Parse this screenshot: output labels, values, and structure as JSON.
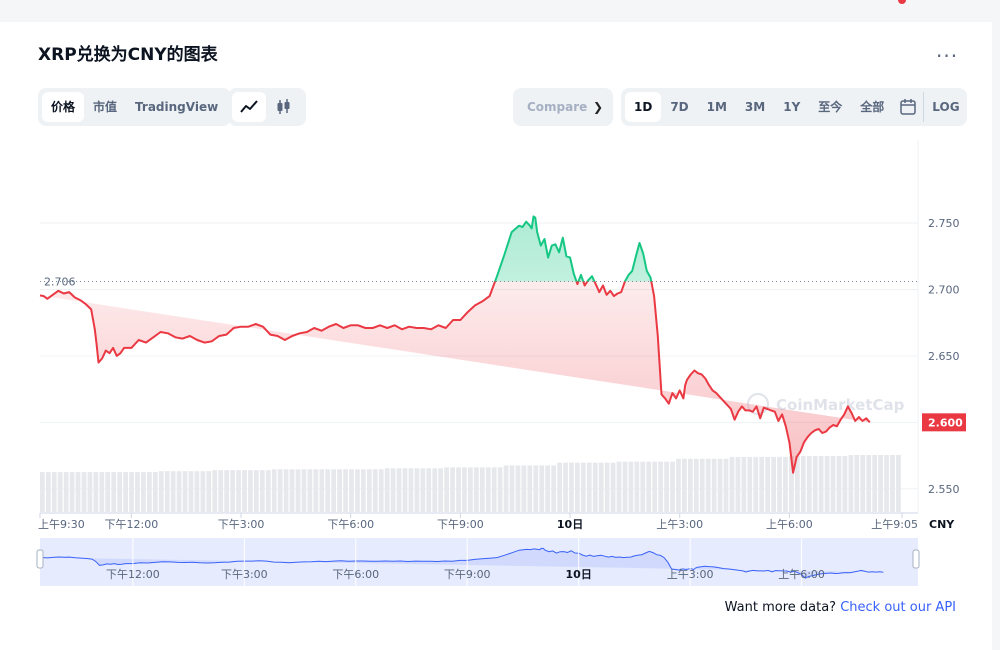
{
  "title": "XRP兑换为CNY的图表",
  "more_label": "...",
  "view_tabs": [
    {
      "label": "价格",
      "active": true
    },
    {
      "label": "市值",
      "active": false
    },
    {
      "label": "TradingView",
      "active": false
    }
  ],
  "chart_type_icons": [
    {
      "icon": "line-chart-icon",
      "active": true
    },
    {
      "icon": "candlestick-icon",
      "active": false
    }
  ],
  "compare_label": "Compare",
  "range_tabs": [
    {
      "label": "1D",
      "active": true
    },
    {
      "label": "7D",
      "active": false
    },
    {
      "label": "1M",
      "active": false
    },
    {
      "label": "3M",
      "active": false
    },
    {
      "label": "1Y",
      "active": false
    },
    {
      "label": "至今",
      "active": false
    },
    {
      "label": "全部",
      "active": false
    }
  ],
  "calendar_icon": "calendar-icon",
  "log_label": "LOG",
  "footer": {
    "text": "Want more data?",
    "link": "Check out our API"
  },
  "watermark": "CoinMarketCap",
  "colors": {
    "up": "#16c784",
    "down": "#ea3943",
    "accent": "#3861fb"
  },
  "chart_data": {
    "type": "line",
    "currency": "CNY",
    "open_price_label": "2.706",
    "current_price_label": "2.600",
    "open_price": 2.706,
    "current_price": 2.6,
    "y_ticks": [
      "2.750",
      "2.700",
      "2.650",
      "2.600",
      "2.550"
    ],
    "y_tick_values": [
      2.75,
      2.7,
      2.65,
      2.6,
      2.55
    ],
    "ylim": [
      2.5325,
      2.8125
    ],
    "x_ticks": [
      "上午9:30",
      "下午12:00",
      "下午3:00",
      "下午6:00",
      "下午9:00",
      "10日",
      "上午3:00",
      "上午6:00",
      "上午9:05"
    ],
    "x_tick_hours": [
      0,
      2.5,
      5.5,
      8.5,
      11.5,
      14.5,
      17.5,
      20.5,
      23.58
    ],
    "navigator_ticks": [
      "下午12:00",
      "下午3:00",
      "下午6:00",
      "下午9:00",
      "10日",
      "上午3:00",
      "上午6:00"
    ],
    "navigator_tick_hours": [
      2.5,
      5.5,
      8.5,
      11.5,
      14.5,
      17.5,
      20.5
    ],
    "hours": [
      0.0,
      0.1,
      0.2,
      0.35,
      0.5,
      0.65,
      0.8,
      0.95,
      1.1,
      1.25,
      1.4,
      1.5,
      1.55,
      1.6,
      1.7,
      1.8,
      1.9,
      2.0,
      2.1,
      2.2,
      2.3,
      2.4,
      2.5,
      2.7,
      2.9,
      3.1,
      3.3,
      3.5,
      3.7,
      3.9,
      4.1,
      4.3,
      4.5,
      4.7,
      4.9,
      5.1,
      5.3,
      5.5,
      5.7,
      5.9,
      6.1,
      6.3,
      6.5,
      6.7,
      6.9,
      7.1,
      7.3,
      7.5,
      7.7,
      7.9,
      8.1,
      8.3,
      8.5,
      8.7,
      8.9,
      9.1,
      9.3,
      9.5,
      9.7,
      9.9,
      10.1,
      10.3,
      10.5,
      10.7,
      10.9,
      11.1,
      11.3,
      11.5,
      11.7,
      11.9,
      12.1,
      12.3,
      12.5,
      12.7,
      12.9,
      13.1,
      13.2,
      13.3,
      13.4,
      13.45,
      13.5,
      13.55,
      13.6,
      13.7,
      13.8,
      13.9,
      14.0,
      14.1,
      14.2,
      14.3,
      14.4,
      14.5,
      14.6,
      14.7,
      14.8,
      14.9,
      15.0,
      15.1,
      15.2,
      15.3,
      15.4,
      15.5,
      15.6,
      15.7,
      15.8,
      15.9,
      16.0,
      16.1,
      16.2,
      16.3,
      16.4,
      16.5,
      16.6,
      16.7,
      16.8,
      16.9,
      17.0,
      17.1,
      17.2,
      17.3,
      17.4,
      17.5,
      17.6,
      17.65,
      17.7,
      17.8,
      17.9,
      18.0,
      18.1,
      18.2,
      18.3,
      18.4,
      18.5,
      18.6,
      18.7,
      18.8,
      18.9,
      19.0,
      19.1,
      19.2,
      19.3,
      19.4,
      19.5,
      19.6,
      19.7,
      19.8,
      19.9,
      20.0,
      20.1,
      20.2,
      20.3,
      20.4,
      20.5,
      20.6,
      20.7,
      20.8,
      20.9,
      21.0,
      21.1,
      21.2,
      21.3,
      21.4,
      21.5,
      21.6,
      21.7,
      21.8,
      21.9,
      22.0,
      22.1,
      22.2,
      22.3,
      22.4,
      22.5,
      22.6,
      22.7,
      22.8,
      22.9,
      23.0,
      23.1,
      23.2,
      23.3,
      23.4,
      23.5,
      23.58
    ],
    "values": [
      2.6955,
      2.695,
      2.693,
      2.696,
      2.699,
      2.697,
      2.698,
      2.694,
      2.692,
      2.689,
      2.685,
      2.67,
      2.658,
      2.645,
      2.648,
      2.654,
      2.652,
      2.656,
      2.65,
      2.652,
      2.656,
      2.656,
      2.656,
      2.662,
      2.66,
      2.664,
      2.668,
      2.667,
      2.664,
      2.663,
      2.665,
      2.662,
      2.66,
      2.661,
      2.665,
      2.666,
      2.671,
      2.672,
      2.672,
      2.674,
      2.672,
      2.666,
      2.665,
      2.662,
      2.665,
      2.667,
      2.668,
      2.671,
      2.669,
      2.672,
      2.674,
      2.671,
      2.673,
      2.673,
      2.671,
      2.671,
      2.673,
      2.671,
      2.673,
      2.67,
      2.672,
      2.671,
      2.671,
      2.67,
      2.673,
      2.671,
      2.677,
      2.677,
      2.683,
      2.688,
      2.691,
      2.695,
      2.71,
      2.726,
      2.743,
      2.748,
      2.747,
      2.751,
      2.748,
      2.746,
      2.755,
      2.754,
      2.743,
      2.733,
      2.738,
      2.724,
      2.733,
      2.734,
      2.728,
      2.739,
      2.725,
      2.724,
      2.712,
      2.704,
      2.711,
      2.703,
      2.707,
      2.71,
      2.704,
      2.698,
      2.703,
      2.696,
      2.699,
      2.695,
      2.697,
      2.698,
      2.706,
      2.711,
      2.714,
      2.725,
      2.735,
      2.727,
      2.714,
      2.709,
      2.695,
      2.665,
      2.621,
      2.618,
      2.614,
      2.622,
      2.618,
      2.624,
      2.618,
      2.628,
      2.632,
      2.636,
      2.639,
      2.637,
      2.636,
      2.633,
      2.628,
      2.624,
      2.622,
      2.619,
      2.616,
      2.613,
      2.61,
      2.602,
      2.608,
      2.612,
      2.609,
      2.609,
      2.608,
      2.612,
      2.603,
      2.611,
      2.61,
      2.609,
      2.608,
      2.601,
      2.606,
      2.597,
      2.585,
      2.562,
      2.574,
      2.578,
      2.585,
      2.589,
      2.592,
      2.594,
      2.595,
      2.592,
      2.593,
      2.596,
      2.598,
      2.597,
      2.602,
      2.606,
      2.612,
      2.607,
      2.601,
      2.604,
      2.601,
      2.603,
      2.6
    ],
    "volume_bars": 145,
    "volume_levels": [
      0.42,
      0.42,
      0.43,
      0.44,
      0.45,
      0.45,
      0.46,
      0.47,
      0.49,
      0.52,
      0.53,
      0.56,
      0.58,
      0.59,
      0.6
    ],
    "navigator_ylim": [
      2.55,
      2.77
    ]
  }
}
